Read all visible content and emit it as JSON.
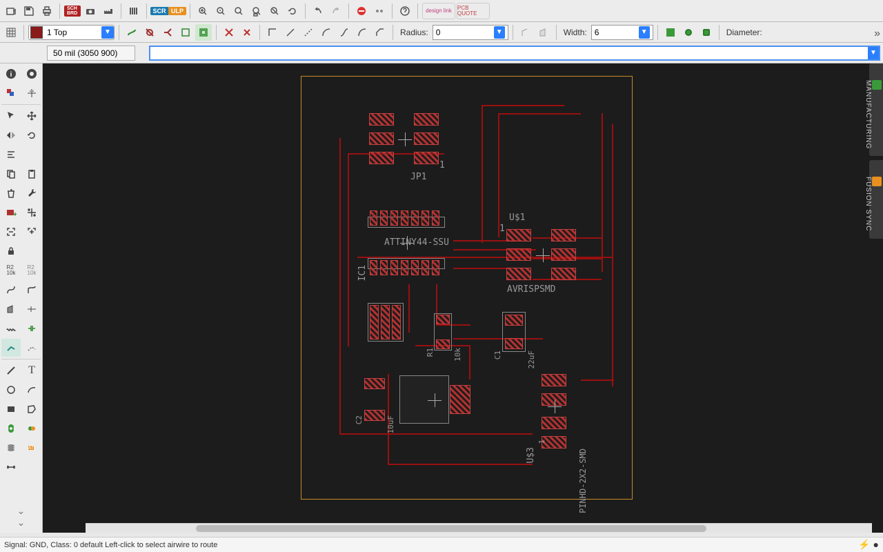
{
  "toolbar1": {
    "scr_badge": "SCR",
    "ulp_badge": "ULP",
    "sch_badge": "SCH\nBRD",
    "design_link": "design link",
    "pcb_quote": "PCB QUOTE"
  },
  "toolbar2": {
    "layer": "1 Top",
    "radius_label": "Radius:",
    "radius_val": "0",
    "width_label": "Width:",
    "width_val": "6",
    "diameter_label": "Diameter:"
  },
  "cmd": {
    "coords": "50 mil (3050 900)",
    "input": ""
  },
  "right_tabs": {
    "mfg": "MANUFACTURING",
    "fusion": "FUSION SYNC"
  },
  "pcb": {
    "ic1": "IC1",
    "ic1_part": "ATTINY44-SSU",
    "jp1": "JP1",
    "us1": "U$1",
    "us1_part": "AVRISPSMD",
    "r1": "R1",
    "r1_val": "10k",
    "c1": "C1",
    "c1_val": "22uF",
    "c2": "C2",
    "c2_val": "10uF",
    "us3": "U$3",
    "us3_num": "1",
    "us3_part": "PINHD-2X2-SMD",
    "us1_num": "1"
  },
  "status": {
    "text": "Signal: GND, Class: 0 default Left-click to select airwire to route"
  }
}
